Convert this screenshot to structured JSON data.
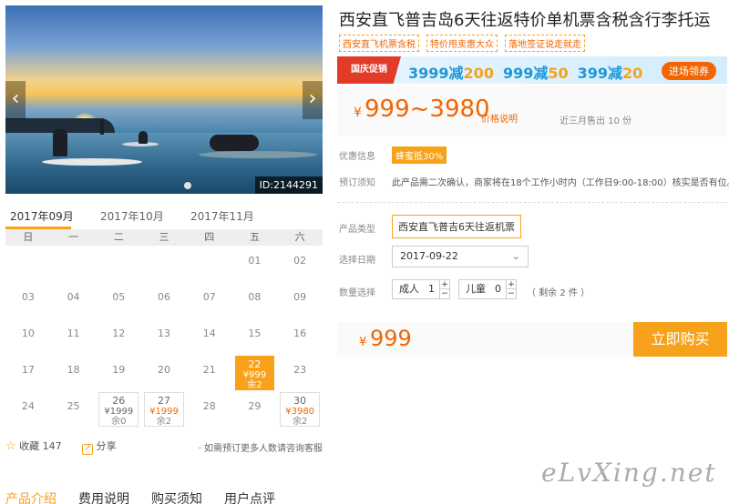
{
  "product": {
    "title": "西安直飞普吉岛6天往返特价单机票含税含行李托运",
    "tags": [
      "西安直飞机票含税",
      "特价甩卖惠大众",
      "落地签证说走就走"
    ]
  },
  "photo": {
    "id_label": "ID:2144291",
    "prev_icon": "chevron-left-icon",
    "next_icon": "chevron-right-icon"
  },
  "promo": {
    "badge": "国庆促销",
    "coupons": [
      {
        "full": "3999减",
        "off": "200"
      },
      {
        "full": "999减",
        "off": "50"
      },
      {
        "full": "399减",
        "off": "20"
      }
    ],
    "button": "进场领券"
  },
  "price": {
    "currency": "¥",
    "range": "999~3980",
    "explain": "价格说明",
    "sold": "近三月售出 10 份"
  },
  "info": {
    "discount_label": "优惠信息",
    "discount_value": "蜂蜜抵30%",
    "notice_label": "预订须知",
    "notice_value": "此产品需二次确认，商家将在18个工作小时内（工作日9:00-18:00）核实是否有位。"
  },
  "form": {
    "type_label": "产品类型",
    "type_value": "西安直飞普吉6天往返机票",
    "date_label": "选择日期",
    "date_value": "2017-09-22",
    "qty_label": "数量选择",
    "adult_label": "成人",
    "adult_value": "1",
    "child_label": "儿童",
    "child_value": "0",
    "remain": "（ 剩余 2 件 ）"
  },
  "buy": {
    "currency": "¥",
    "amount": "999",
    "button": "立即购买"
  },
  "calendar": {
    "months": [
      "2017年09月",
      "2017年10月",
      "2017年11月"
    ],
    "weekdays": [
      "日",
      "一",
      "二",
      "三",
      "四",
      "五",
      "六"
    ],
    "rows": [
      [
        {
          "d": ""
        },
        {
          "d": ""
        },
        {
          "d": ""
        },
        {
          "d": ""
        },
        {
          "d": ""
        },
        {
          "d": "01"
        },
        {
          "d": "02"
        }
      ],
      [
        {
          "d": "03"
        },
        {
          "d": "04"
        },
        {
          "d": "05"
        },
        {
          "d": "06"
        },
        {
          "d": "07"
        },
        {
          "d": "08"
        },
        {
          "d": "09"
        }
      ],
      [
        {
          "d": "10"
        },
        {
          "d": "11"
        },
        {
          "d": "12"
        },
        {
          "d": "13"
        },
        {
          "d": "14"
        },
        {
          "d": "15"
        },
        {
          "d": "16"
        }
      ],
      [
        {
          "d": "17"
        },
        {
          "d": "18"
        },
        {
          "d": "19"
        },
        {
          "d": "20"
        },
        {
          "d": "21"
        },
        {
          "d": "22",
          "price": "¥999",
          "stock": "余2",
          "selected": true
        },
        {
          "d": "23"
        }
      ],
      [
        {
          "d": "24"
        },
        {
          "d": "25"
        },
        {
          "d": "26",
          "price": "¥1999",
          "stock": "余0"
        },
        {
          "d": "27",
          "price": "¥1999",
          "stock": "余2",
          "orange": true
        },
        {
          "d": "28"
        },
        {
          "d": "29"
        },
        {
          "d": "30",
          "price": "¥3980",
          "stock": "余2",
          "orange": true
        }
      ]
    ]
  },
  "actions": {
    "favorite_label": "收藏",
    "favorite_count": "147",
    "share_label": "分享",
    "consult": "· 如需预订更多人数请咨询客服"
  },
  "watermark": "eLvXing.net",
  "tabs": [
    "产品介绍",
    "费用说明",
    "购买须知",
    "用户点评"
  ]
}
